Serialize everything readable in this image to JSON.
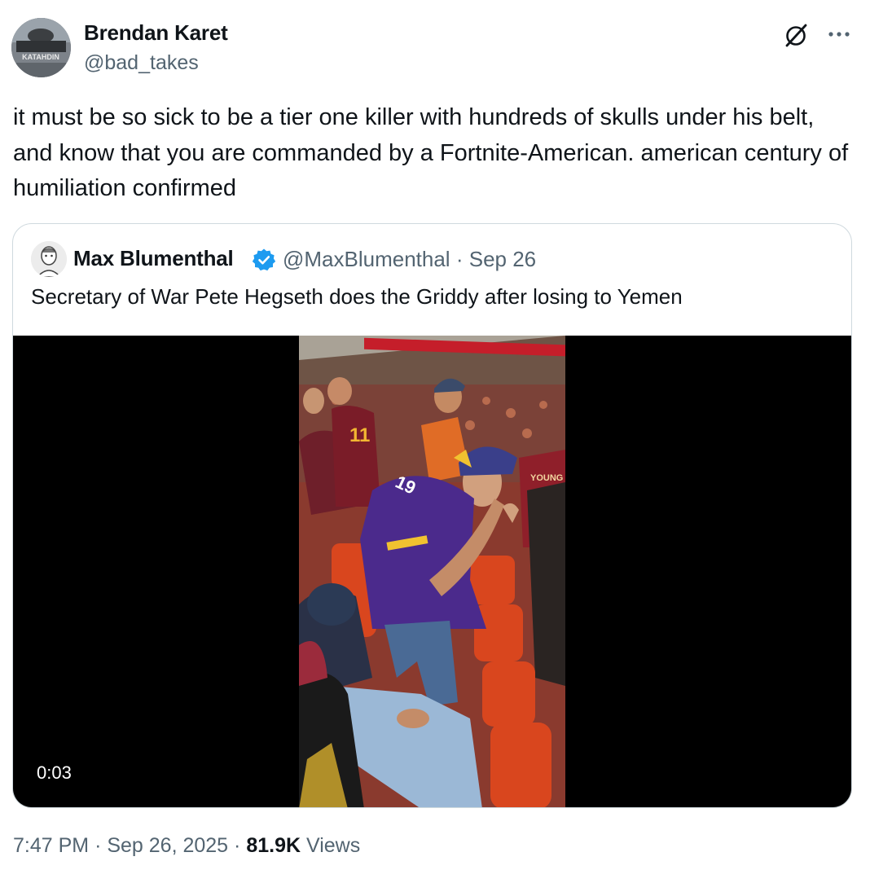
{
  "author": {
    "name": "Brendan Karet",
    "handle": "@bad_takes",
    "avatar_text": "KATAHDIN"
  },
  "icons": {
    "grok": "grok-icon",
    "more": "more-icon",
    "verified": "verified-badge-icon"
  },
  "tweet": {
    "text": "it must be so sick to be a tier one killer with hundreds of skulls under his belt, and know that you are commanded by a Fortnite-American. american century of humiliation confirmed"
  },
  "quote": {
    "name": "Max Blumenthal",
    "handle": "@MaxBlumenthal",
    "separator": "·",
    "date": "Sep 26",
    "text": "Secretary of War Pete Hegseth does the Griddy after losing to Yemen",
    "video": {
      "duration": "0:03",
      "jersey_number": "19",
      "back_jersey_text": "YOUNG"
    }
  },
  "meta": {
    "time": "7:47 PM",
    "separator": "·",
    "date": "Sep 26, 2025",
    "views_count": "81.9K",
    "views_label": "Views"
  },
  "colors": {
    "text_primary": "#0f1419",
    "text_secondary": "#536471",
    "border": "#cfd9de",
    "verified_blue": "#1d9bf0"
  }
}
